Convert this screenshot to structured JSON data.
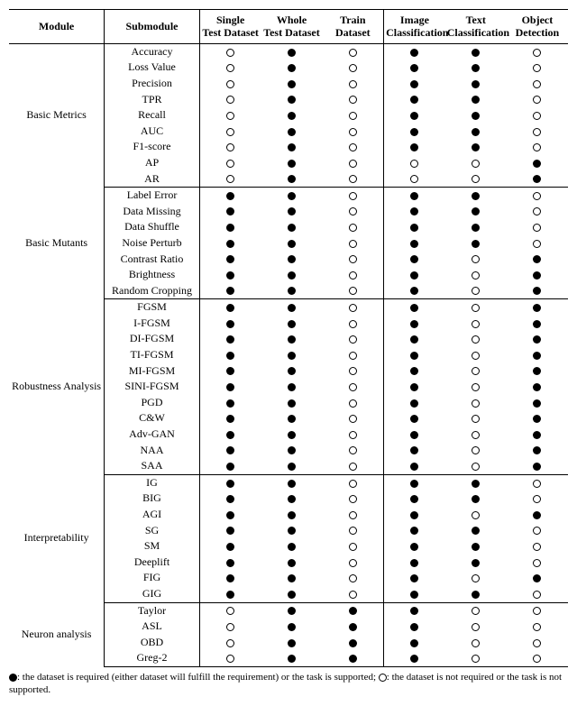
{
  "header": {
    "module": "Module",
    "submodule": "Submodule",
    "cols": [
      "Single\nTest Dataset",
      "Whole\nTest Dataset",
      "Train\nDataset",
      "Image\nClassification",
      "Text\nClassification",
      "Object\nDetection"
    ]
  },
  "groups": [
    {
      "module": "Basic Metrics",
      "rows": [
        {
          "name": "Accuracy",
          "v": [
            0,
            1,
            0,
            1,
            1,
            0
          ]
        },
        {
          "name": "Loss Value",
          "v": [
            0,
            1,
            0,
            1,
            1,
            0
          ]
        },
        {
          "name": "Precision",
          "v": [
            0,
            1,
            0,
            1,
            1,
            0
          ]
        },
        {
          "name": "TPR",
          "v": [
            0,
            1,
            0,
            1,
            1,
            0
          ]
        },
        {
          "name": "Recall",
          "v": [
            0,
            1,
            0,
            1,
            1,
            0
          ]
        },
        {
          "name": "AUC",
          "v": [
            0,
            1,
            0,
            1,
            1,
            0
          ]
        },
        {
          "name": "F1-score",
          "v": [
            0,
            1,
            0,
            1,
            1,
            0
          ]
        },
        {
          "name": "AP",
          "v": [
            0,
            1,
            0,
            0,
            0,
            1
          ]
        },
        {
          "name": "AR",
          "v": [
            0,
            1,
            0,
            0,
            0,
            1
          ]
        }
      ]
    },
    {
      "module": "Basic Mutants",
      "rows": [
        {
          "name": "Label Error",
          "v": [
            1,
            1,
            0,
            1,
            1,
            0
          ]
        },
        {
          "name": "Data Missing",
          "v": [
            1,
            1,
            0,
            1,
            1,
            0
          ]
        },
        {
          "name": "Data Shuffle",
          "v": [
            1,
            1,
            0,
            1,
            1,
            0
          ]
        },
        {
          "name": "Noise Perturb",
          "v": [
            1,
            1,
            0,
            1,
            1,
            0
          ]
        },
        {
          "name": "Contrast Ratio",
          "v": [
            1,
            1,
            0,
            1,
            0,
            1
          ]
        },
        {
          "name": "Brightness",
          "v": [
            1,
            1,
            0,
            1,
            0,
            1
          ]
        },
        {
          "name": "Random Cropping",
          "v": [
            1,
            1,
            0,
            1,
            0,
            1
          ]
        }
      ]
    },
    {
      "module": "Robustness Analysis",
      "rows": [
        {
          "name": "FGSM",
          "v": [
            1,
            1,
            0,
            1,
            0,
            1
          ]
        },
        {
          "name": "I-FGSM",
          "v": [
            1,
            1,
            0,
            1,
            0,
            1
          ]
        },
        {
          "name": "DI-FGSM",
          "v": [
            1,
            1,
            0,
            1,
            0,
            1
          ]
        },
        {
          "name": "TI-FGSM",
          "v": [
            1,
            1,
            0,
            1,
            0,
            1
          ]
        },
        {
          "name": "MI-FGSM",
          "v": [
            1,
            1,
            0,
            1,
            0,
            1
          ]
        },
        {
          "name": "SINI-FGSM",
          "v": [
            1,
            1,
            0,
            1,
            0,
            1
          ]
        },
        {
          "name": "PGD",
          "v": [
            1,
            1,
            0,
            1,
            0,
            1
          ]
        },
        {
          "name": "C&W",
          "v": [
            1,
            1,
            0,
            1,
            0,
            1
          ]
        },
        {
          "name": "Adv-GAN",
          "v": [
            1,
            1,
            0,
            1,
            0,
            1
          ]
        },
        {
          "name": "NAA",
          "v": [
            1,
            1,
            0,
            1,
            0,
            1
          ]
        },
        {
          "name": "SAA",
          "v": [
            1,
            1,
            0,
            1,
            0,
            1
          ]
        }
      ]
    },
    {
      "module": "Interpretability",
      "rows": [
        {
          "name": "IG",
          "v": [
            1,
            1,
            0,
            1,
            1,
            0
          ]
        },
        {
          "name": "BIG",
          "v": [
            1,
            1,
            0,
            1,
            1,
            0
          ]
        },
        {
          "name": "AGI",
          "v": [
            1,
            1,
            0,
            1,
            0,
            1
          ]
        },
        {
          "name": "SG",
          "v": [
            1,
            1,
            0,
            1,
            1,
            0
          ]
        },
        {
          "name": "SM",
          "v": [
            1,
            1,
            0,
            1,
            1,
            0
          ]
        },
        {
          "name": "Deeplift",
          "v": [
            1,
            1,
            0,
            1,
            1,
            0
          ]
        },
        {
          "name": "FIG",
          "v": [
            1,
            1,
            0,
            1,
            0,
            1
          ]
        },
        {
          "name": "GIG",
          "v": [
            1,
            1,
            0,
            1,
            1,
            0
          ]
        }
      ]
    },
    {
      "module": "Neuron analysis",
      "rows": [
        {
          "name": "Taylor",
          "v": [
            0,
            1,
            1,
            1,
            0,
            0
          ]
        },
        {
          "name": "ASL",
          "v": [
            0,
            1,
            1,
            1,
            0,
            0
          ]
        },
        {
          "name": "OBD",
          "v": [
            0,
            1,
            1,
            1,
            0,
            0
          ]
        },
        {
          "name": "Greg-2",
          "v": [
            0,
            1,
            1,
            1,
            0,
            0
          ]
        }
      ]
    }
  ],
  "legend": {
    "filled": ": the dataset is required (either dataset will fulfill the requirement) or the task is supported;",
    "open": ": the dataset is not required or the task is not supported."
  }
}
